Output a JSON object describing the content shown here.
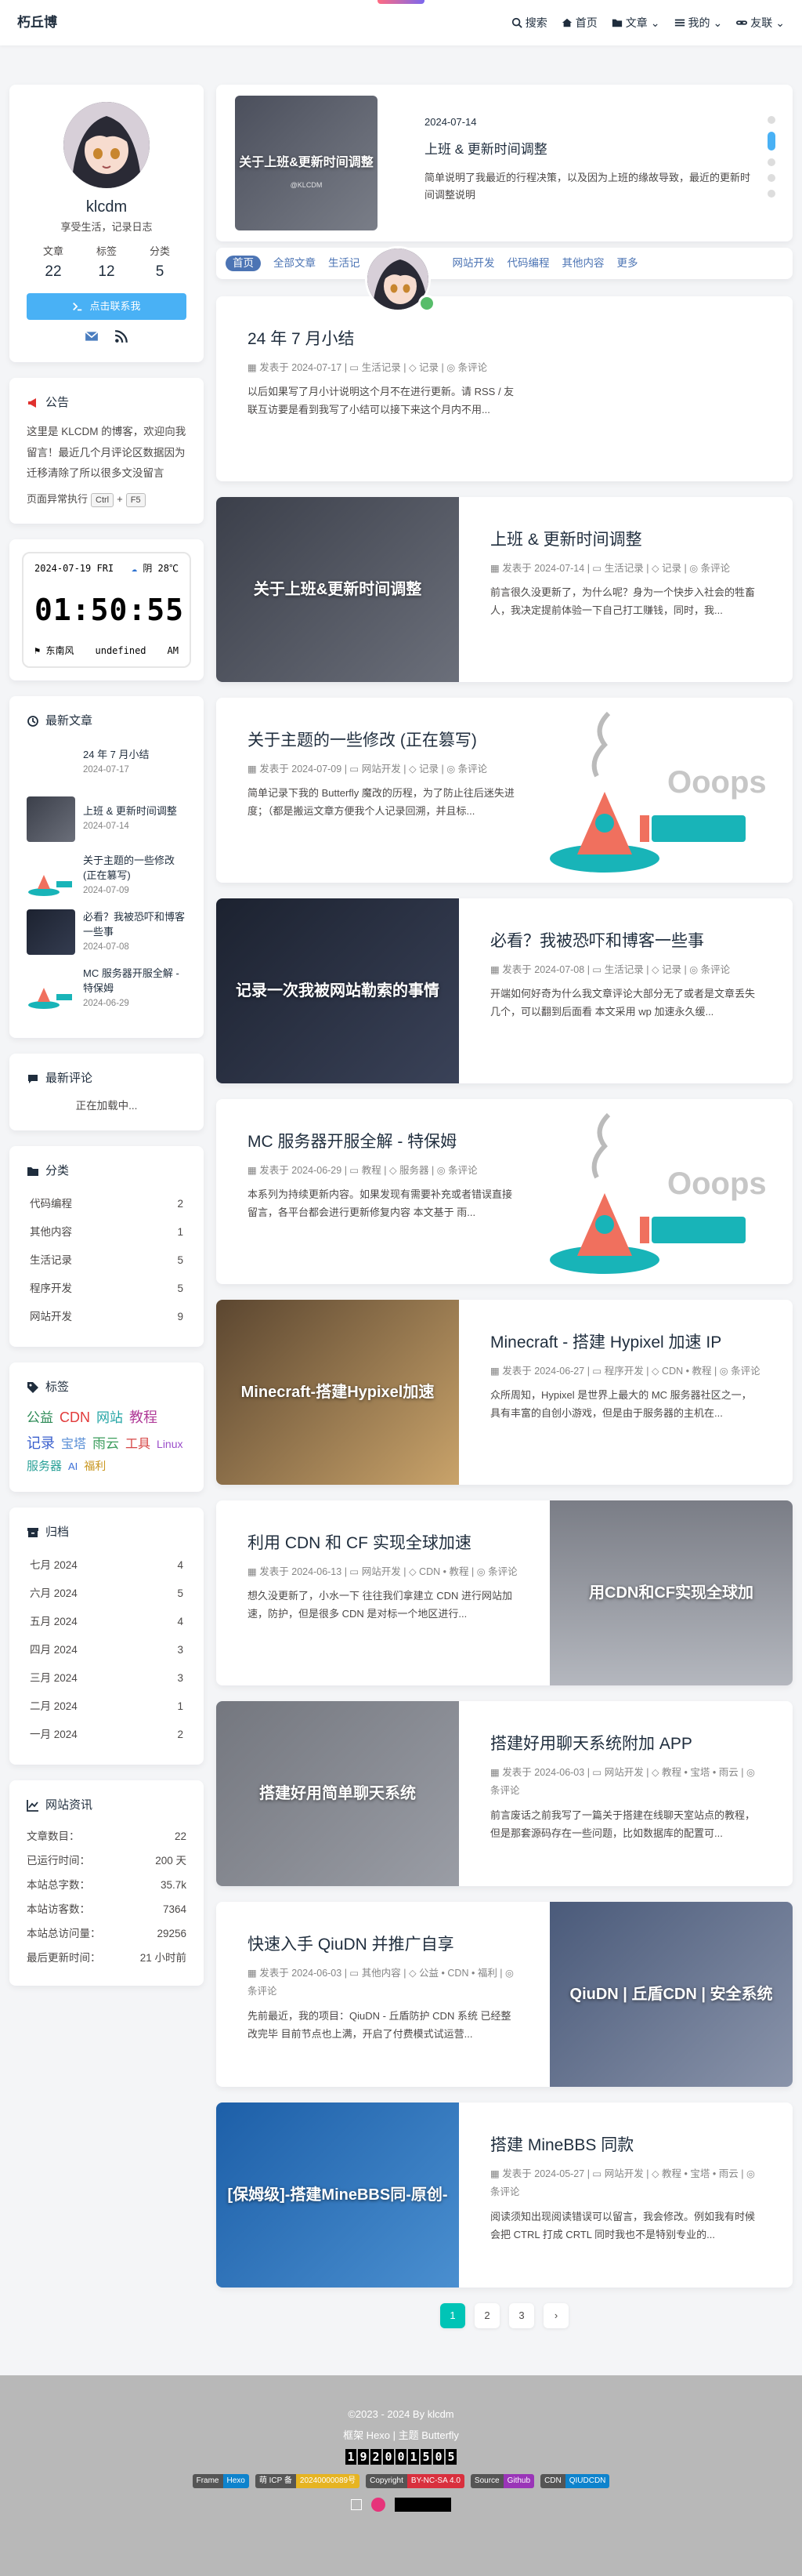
{
  "nav": {
    "title": "朽丘博",
    "menus": [
      {
        "label": "搜索",
        "icon": "search-icon"
      },
      {
        "label": "首页",
        "icon": "home-icon"
      },
      {
        "label": "文章",
        "icon": "folder-icon"
      },
      {
        "label": "我的",
        "icon": "list-icon"
      },
      {
        "label": "友联",
        "icon": "link-icon"
      }
    ]
  },
  "author": {
    "name": "klcdm",
    "desc": "享受生活，记录日志",
    "stats": [
      {
        "label": "文章",
        "value": "22"
      },
      {
        "label": "标签",
        "value": "12"
      },
      {
        "label": "分类",
        "value": "5"
      }
    ],
    "button": "点击联系我"
  },
  "announcement": {
    "title": "公告",
    "text": "这里是 KLCDM 的博客，欢迎向我留言！最近几个月评论区数据因为迁移清除了所以很多文没留言",
    "hint": "页面异常执行",
    "key1": "Ctrl",
    "plus": "+",
    "key2": "F5"
  },
  "clock": {
    "date": "2024-07-19 FRI",
    "weather": "阴 28℃",
    "time": "01:50:55",
    "wind": "东南风",
    "extra": "undefined",
    "ampm": "AM"
  },
  "recent": {
    "title": "最新文章",
    "items": [
      {
        "title": "24 年 7 月小结",
        "date": "2024-07-17"
      },
      {
        "title": "上班 & 更新时间调整",
        "date": "2024-07-14"
      },
      {
        "title": "关于主题的一些修改 (正在篡写)",
        "date": "2024-07-09"
      },
      {
        "title": "必看？我被恐吓和博客一些事",
        "date": "2024-07-08"
      },
      {
        "title": "MC 服务器开服全解 - 特保姆",
        "date": "2024-06-29"
      }
    ]
  },
  "comments": {
    "title": "最新评论",
    "loading": "正在加载中..."
  },
  "categories": {
    "title": "分类",
    "items": [
      {
        "name": "代码编程",
        "count": "2"
      },
      {
        "name": "其他内容",
        "count": "1"
      },
      {
        "name": "生活记录",
        "count": "5"
      },
      {
        "name": "程序开发",
        "count": "5"
      },
      {
        "name": "网站开发",
        "count": "9"
      }
    ]
  },
  "tags": {
    "title": "标签",
    "items": [
      {
        "name": "公益",
        "color": "#2e8b57",
        "size": "17px"
      },
      {
        "name": "CDN",
        "color": "#e23b3b",
        "size": "18px"
      },
      {
        "name": "网站",
        "color": "#25a6a6",
        "size": "17px"
      },
      {
        "name": "教程",
        "color": "#b03a98",
        "size": "18px"
      },
      {
        "name": "记录",
        "color": "#3a5fcd",
        "size": "18px"
      },
      {
        "name": "宝塔",
        "color": "#5a8fd6",
        "size": "16px"
      },
      {
        "name": "雨云",
        "color": "#3c9d5d",
        "size": "17px"
      },
      {
        "name": "工具",
        "color": "#d64545",
        "size": "16px"
      },
      {
        "name": "Linux",
        "color": "#9b4dca",
        "size": "14px"
      },
      {
        "name": "服务器",
        "color": "#2aa198",
        "size": "15px"
      },
      {
        "name": "AI",
        "color": "#3b6fd6",
        "size": "13px"
      },
      {
        "name": "福利",
        "color": "#c8961e",
        "size": "14px"
      }
    ]
  },
  "archives": {
    "title": "归档",
    "items": [
      {
        "name": "七月 2024",
        "count": "4"
      },
      {
        "name": "六月 2024",
        "count": "5"
      },
      {
        "name": "五月 2024",
        "count": "4"
      },
      {
        "name": "四月 2024",
        "count": "3"
      },
      {
        "name": "三月 2024",
        "count": "3"
      },
      {
        "name": "二月 2024",
        "count": "1"
      },
      {
        "name": "一月 2024",
        "count": "2"
      }
    ]
  },
  "webinfo": {
    "title": "网站资讯",
    "items": [
      {
        "name": "文章数目：",
        "value": "22"
      },
      {
        "name": "已运行时间：",
        "value": "200 天"
      },
      {
        "name": "本站总字数：",
        "value": "35.7k"
      },
      {
        "name": "本站访客数：",
        "value": "7364"
      },
      {
        "name": "本站总访问量：",
        "value": "29256"
      },
      {
        "name": "最后更新时间：",
        "value": "21 小时前"
      }
    ]
  },
  "top": {
    "date": "2024-07-14",
    "title": "上班 & 更新时间调整",
    "desc": "简单说明了我最近的行程决策，以及因为上班的缘故导致，最近的更新时间调整说明",
    "cover_text": "关于上班&更新时间调整",
    "cover_sub": "@KLCDM"
  },
  "catbar": [
    "首页",
    "全部文章",
    "生活记",
    "",
    "网站开发",
    "代码编程",
    "其他内容",
    "更多"
  ],
  "posts": [
    {
      "title": "24 年 7 月小结",
      "date": "2024-07-17",
      "cat": "生活记录",
      "tags": "记录",
      "comments": "条评论",
      "desc": "以后如果写了月小计说明这个月不在进行更新。请 RSS / 友联互访要是看到我写了小结可以接下来这个月内不用...",
      "cover": "blank",
      "cover_text": ""
    },
    {
      "title": "上班 & 更新时间调整",
      "date": "2024-07-14",
      "cat": "生活记录",
      "tags": "记录",
      "comments": "条评论",
      "desc": "前言很久没更新了，为什么呢？身为一个快步入社会的牲畜人，我决定提前体验一下自己打工赚钱，同时，我...",
      "cover": "dark",
      "cover_text": "关于上班&更新时间调整"
    },
    {
      "title": "关于主题的一些修改 (正在篡写)",
      "date": "2024-07-09",
      "cat": "网站开发",
      "tags": "记录",
      "comments": "条评论",
      "desc": "简单记录下我的 Butterfly 魔改的历程，为了防止往后迷失进度；（都是搬运文章方便我个人记录回溯，并且标...",
      "cover": "oops",
      "cover_text": "Ooops"
    },
    {
      "title": "必看？我被恐吓和博客一些事",
      "date": "2024-07-08",
      "cat": "生活记录",
      "tags": "记录",
      "comments": "条评论",
      "desc": "开端如何好奇为什么我文章评论大部分无了或者是文章丢失几个，可以翻到后面看 本文采用 wp 加速永久缓...",
      "cover": "navy",
      "cover_text": "记录一次我被网站勒索的事情"
    },
    {
      "title": "MC 服务器开服全解 - 特保姆",
      "date": "2024-06-29",
      "cat": "教程",
      "tags": "服务器",
      "comments": "条评论",
      "desc": "本系列为持续更新内容。如果发现有需要补充或者错误直接留言，各平台都会进行更新修复内容 本文基于 雨...",
      "cover": "oops",
      "cover_text": "Ooops"
    },
    {
      "title": "Minecraft - 搭建 Hypixel 加速 IP",
      "date": "2024-06-27",
      "cat": "程序开发",
      "tags": "CDN",
      "tags2": "教程",
      "comments": "条评论",
      "desc": "众所周知，Hypixel 是世界上最大的 MC 服务器社区之一，具有丰富的自创小游戏，但是由于服务器的主机在...",
      "cover": "game",
      "cover_text": "Minecraft-搭建Hypixel加速"
    },
    {
      "title": "利用 CDN 和 CF 实现全球加速",
      "date": "2024-06-13",
      "cat": "网站开发",
      "tags": "CDN",
      "tags2": "教程",
      "comments": "条评论",
      "desc": "想久没更新了，小水一下 往往我们拿建立 CDN 进行网站加速，防护，但是很多 CDN 是对标一个地区进行...",
      "cover": "cloud",
      "cover_text": "用CDN和CF实现全球加"
    },
    {
      "title": "搭建好用聊天系统附加 APP",
      "date": "2024-06-03",
      "cat": "网站开发",
      "tags": "教程",
      "tags2": "宝塔",
      "tags3": "雨云",
      "comments": "条评论",
      "desc": "前言废话之前我写了一篇关于搭建在线聊天室站点的教程，但是那套源码存在一些问题，比如数据库的配置可...",
      "cover": "gray",
      "cover_text": "搭建好用简单聊天系统"
    },
    {
      "title": "快速入手 QiuDN 并推广自享",
      "date": "2024-06-03",
      "cat": "其他内容",
      "tags": "公益",
      "tags2": "CDN",
      "tags3": "福利",
      "comments": "条评论",
      "desc": "先前最近，我的项目：QiuDN - 丘盾防护 CDN 系统 已经整改完毕 目前节点也上满，开启了付费模式试运营...",
      "cover": "qiudn",
      "cover_text": "QiuDN | 丘盾CDN | 安全系统"
    },
    {
      "title": "搭建 MineBBS 同款",
      "date": "2024-05-27",
      "cat": "网站开发",
      "tags": "教程",
      "tags2": "宝塔",
      "tags3": "雨云",
      "comments": "条评论",
      "desc": "阅读须知出现阅读错误可以留言，我会修改。例如我有时候会把 CTRL 打成 CRTL 同时我也不是特别专业的...",
      "cover": "blue",
      "cover_text": "[保姆级]-搭建MineBBS同-原创-"
    }
  ],
  "pagination": [
    "1",
    "2",
    "3"
  ],
  "footer": {
    "copyright": "©2023 - 2024 By klcdm",
    "framework": "框架 Hexo | 主题 Butterfly",
    "digits": "192001505",
    "badges": [
      {
        "l": "Frame",
        "r": "Hexo",
        "color": "#0e83cd"
      },
      {
        "l": "萌 ICP 备",
        "r": "20240000089号",
        "color": "#e6b422"
      },
      {
        "l": "Copyright",
        "r": "BY-NC-SA 4.0",
        "color": "#d9303e"
      },
      {
        "l": "Source",
        "r": "Github",
        "color": "#9a35b8"
      },
      {
        "l": "CDN",
        "r": "QIUDCDN",
        "color": "#0e83cd"
      }
    ]
  }
}
